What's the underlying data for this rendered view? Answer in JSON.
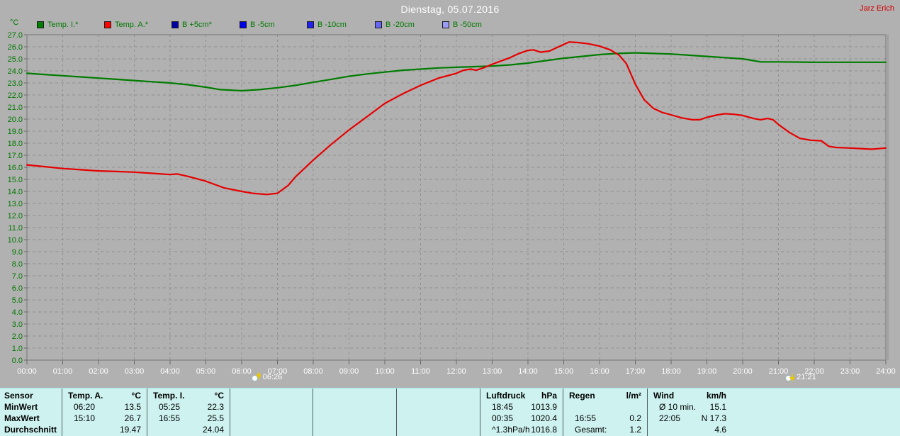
{
  "header": {
    "title": "Dienstag, 05.07.2016",
    "author": "Jarz Erich"
  },
  "chart_data": {
    "type": "line",
    "title": "Dienstag, 05.07.2016",
    "y_unit": "°C",
    "ylim": [
      0,
      27
    ],
    "y_tick_step": 1,
    "xlim": [
      0,
      24
    ],
    "grid": true,
    "x_tick_labels": [
      "00:00",
      "01:00",
      "02:00",
      "03:00",
      "04:00",
      "05:00",
      "06:00",
      "07:00",
      "08:00",
      "09:00",
      "10:00",
      "11:00",
      "12:00",
      "13:00",
      "14:00",
      "15:00",
      "16:00",
      "17:00",
      "18:00",
      "19:00",
      "20:00",
      "21:00",
      "22:00",
      "23:00",
      "24:00"
    ],
    "legend": [
      {
        "label": "Temp. I.*",
        "color": "#008000"
      },
      {
        "label": "Temp. A.*",
        "color": "#ff0000"
      },
      {
        "label": "B +5cm*",
        "color": "#0000a0"
      },
      {
        "label": "B -5cm",
        "color": "#0000e8"
      },
      {
        "label": "B -10cm",
        "color": "#2222f0"
      },
      {
        "label": "B -20cm",
        "color": "#6666f6"
      },
      {
        "label": "B -50cm",
        "color": "#9a9af8"
      }
    ],
    "series": [
      {
        "name": "Temp. I.*",
        "color": "#007c00",
        "points": [
          [
            0,
            23.8
          ],
          [
            0.5,
            23.7
          ],
          [
            1,
            23.6
          ],
          [
            1.5,
            23.5
          ],
          [
            2,
            23.4
          ],
          [
            2.5,
            23.3
          ],
          [
            3,
            23.2
          ],
          [
            3.5,
            23.1
          ],
          [
            4,
            23.0
          ],
          [
            4.5,
            22.85
          ],
          [
            5,
            22.65
          ],
          [
            5.4,
            22.45
          ],
          [
            6,
            22.35
          ],
          [
            6.5,
            22.45
          ],
          [
            7,
            22.6
          ],
          [
            7.5,
            22.8
          ],
          [
            8,
            23.05
          ],
          [
            8.5,
            23.3
          ],
          [
            9,
            23.55
          ],
          [
            9.5,
            23.75
          ],
          [
            10,
            23.9
          ],
          [
            10.5,
            24.05
          ],
          [
            11,
            24.15
          ],
          [
            11.5,
            24.25
          ],
          [
            12,
            24.3
          ],
          [
            12.5,
            24.35
          ],
          [
            13,
            24.4
          ],
          [
            13.5,
            24.5
          ],
          [
            14,
            24.65
          ],
          [
            14.5,
            24.85
          ],
          [
            15,
            25.05
          ],
          [
            15.5,
            25.2
          ],
          [
            16,
            25.35
          ],
          [
            16.5,
            25.45
          ],
          [
            17,
            25.5
          ],
          [
            17.5,
            25.45
          ],
          [
            18,
            25.4
          ],
          [
            18.5,
            25.3
          ],
          [
            19,
            25.2
          ],
          [
            19.5,
            25.1
          ],
          [
            20,
            25.0
          ],
          [
            20.3,
            24.85
          ],
          [
            20.5,
            24.75
          ],
          [
            21,
            24.75
          ],
          [
            22,
            24.72
          ],
          [
            23,
            24.72
          ],
          [
            24,
            24.72
          ]
        ]
      },
      {
        "name": "Temp. A.*",
        "color": "#e60000",
        "points": [
          [
            0,
            16.2
          ],
          [
            0.5,
            16.05
          ],
          [
            1,
            15.9
          ],
          [
            1.5,
            15.8
          ],
          [
            2,
            15.7
          ],
          [
            2.5,
            15.65
          ],
          [
            3,
            15.6
          ],
          [
            3.5,
            15.5
          ],
          [
            4,
            15.4
          ],
          [
            4.2,
            15.45
          ],
          [
            4.5,
            15.25
          ],
          [
            5,
            14.85
          ],
          [
            5.5,
            14.3
          ],
          [
            6,
            14.0
          ],
          [
            6.3,
            13.85
          ],
          [
            6.7,
            13.75
          ],
          [
            7,
            13.85
          ],
          [
            7.3,
            14.5
          ],
          [
            7.5,
            15.2
          ],
          [
            8,
            16.6
          ],
          [
            8.5,
            17.9
          ],
          [
            9,
            19.1
          ],
          [
            9.5,
            20.2
          ],
          [
            10,
            21.3
          ],
          [
            10.5,
            22.1
          ],
          [
            11,
            22.8
          ],
          [
            11.5,
            23.4
          ],
          [
            12,
            23.8
          ],
          [
            12.2,
            24.05
          ],
          [
            12.4,
            24.15
          ],
          [
            12.55,
            24.05
          ],
          [
            12.8,
            24.3
          ],
          [
            13,
            24.55
          ],
          [
            13.5,
            25.1
          ],
          [
            13.75,
            25.45
          ],
          [
            14,
            25.7
          ],
          [
            14.15,
            25.75
          ],
          [
            14.35,
            25.55
          ],
          [
            14.6,
            25.65
          ],
          [
            15,
            26.2
          ],
          [
            15.15,
            26.4
          ],
          [
            15.4,
            26.35
          ],
          [
            15.7,
            26.25
          ],
          [
            16,
            26.05
          ],
          [
            16.3,
            25.75
          ],
          [
            16.55,
            25.3
          ],
          [
            16.75,
            24.6
          ],
          [
            17,
            22.9
          ],
          [
            17.25,
            21.6
          ],
          [
            17.5,
            20.9
          ],
          [
            17.75,
            20.55
          ],
          [
            18,
            20.35
          ],
          [
            18.3,
            20.1
          ],
          [
            18.6,
            19.95
          ],
          [
            18.8,
            19.95
          ],
          [
            19,
            20.15
          ],
          [
            19.3,
            20.35
          ],
          [
            19.5,
            20.45
          ],
          [
            19.75,
            20.4
          ],
          [
            20,
            20.3
          ],
          [
            20.3,
            20.05
          ],
          [
            20.5,
            19.95
          ],
          [
            20.7,
            20.05
          ],
          [
            20.85,
            19.95
          ],
          [
            21,
            19.55
          ],
          [
            21.3,
            18.9
          ],
          [
            21.6,
            18.4
          ],
          [
            21.9,
            18.25
          ],
          [
            22.2,
            18.2
          ],
          [
            22.4,
            17.75
          ],
          [
            22.6,
            17.65
          ],
          [
            23,
            17.6
          ],
          [
            23.3,
            17.55
          ],
          [
            23.6,
            17.5
          ],
          [
            24,
            17.6
          ]
        ]
      }
    ],
    "sun_markers": [
      {
        "type": "sunrise",
        "hour": 6.43,
        "time_label": "06:26"
      },
      {
        "type": "sunset",
        "hour": 21.35,
        "time_label": "21:21"
      }
    ]
  },
  "summary_table": {
    "row_labels": [
      "Sensor",
      "MinWert",
      "MaxWert",
      "Durchschnitt"
    ],
    "columns": [
      {
        "header": "Temp. A.",
        "unit": "°C",
        "rows": [
          [
            "06:20",
            "13.5"
          ],
          [
            "15:10",
            "26.7"
          ],
          [
            "",
            "19.47"
          ]
        ]
      },
      {
        "header": "Temp. I.",
        "unit": "°C",
        "rows": [
          [
            "05:25",
            "22.3"
          ],
          [
            "16:55",
            "25.5"
          ],
          [
            "",
            "24.04"
          ]
        ]
      },
      {
        "header": "",
        "unit": "",
        "rows": [
          [
            "",
            ""
          ],
          [
            "",
            ""
          ],
          [
            "",
            ""
          ]
        ]
      },
      {
        "header": "",
        "unit": "",
        "rows": [
          [
            "",
            ""
          ],
          [
            "",
            ""
          ],
          [
            "",
            ""
          ]
        ]
      },
      {
        "header": "",
        "unit": "",
        "rows": [
          [
            "",
            ""
          ],
          [
            "",
            ""
          ],
          [
            "",
            ""
          ]
        ]
      },
      {
        "header": "Luftdruck",
        "unit": "hPa",
        "rows": [
          [
            "18:45",
            "1013.9"
          ],
          [
            "00:35",
            "1020.4"
          ],
          [
            "^1.3hPa/h",
            "1016.8"
          ]
        ]
      },
      {
        "header": "Regen",
        "unit": "l/m²",
        "rows": [
          [
            "",
            ""
          ],
          [
            "16:55",
            "0.2"
          ],
          [
            "Gesamt:",
            "1.2"
          ]
        ]
      },
      {
        "header": "Wind",
        "unit": "km/h",
        "rows": [
          [
            "Ø 10 min.",
            "15.1"
          ],
          [
            "22:05",
            "N 17.3"
          ],
          [
            "",
            "4.6"
          ]
        ]
      }
    ]
  }
}
